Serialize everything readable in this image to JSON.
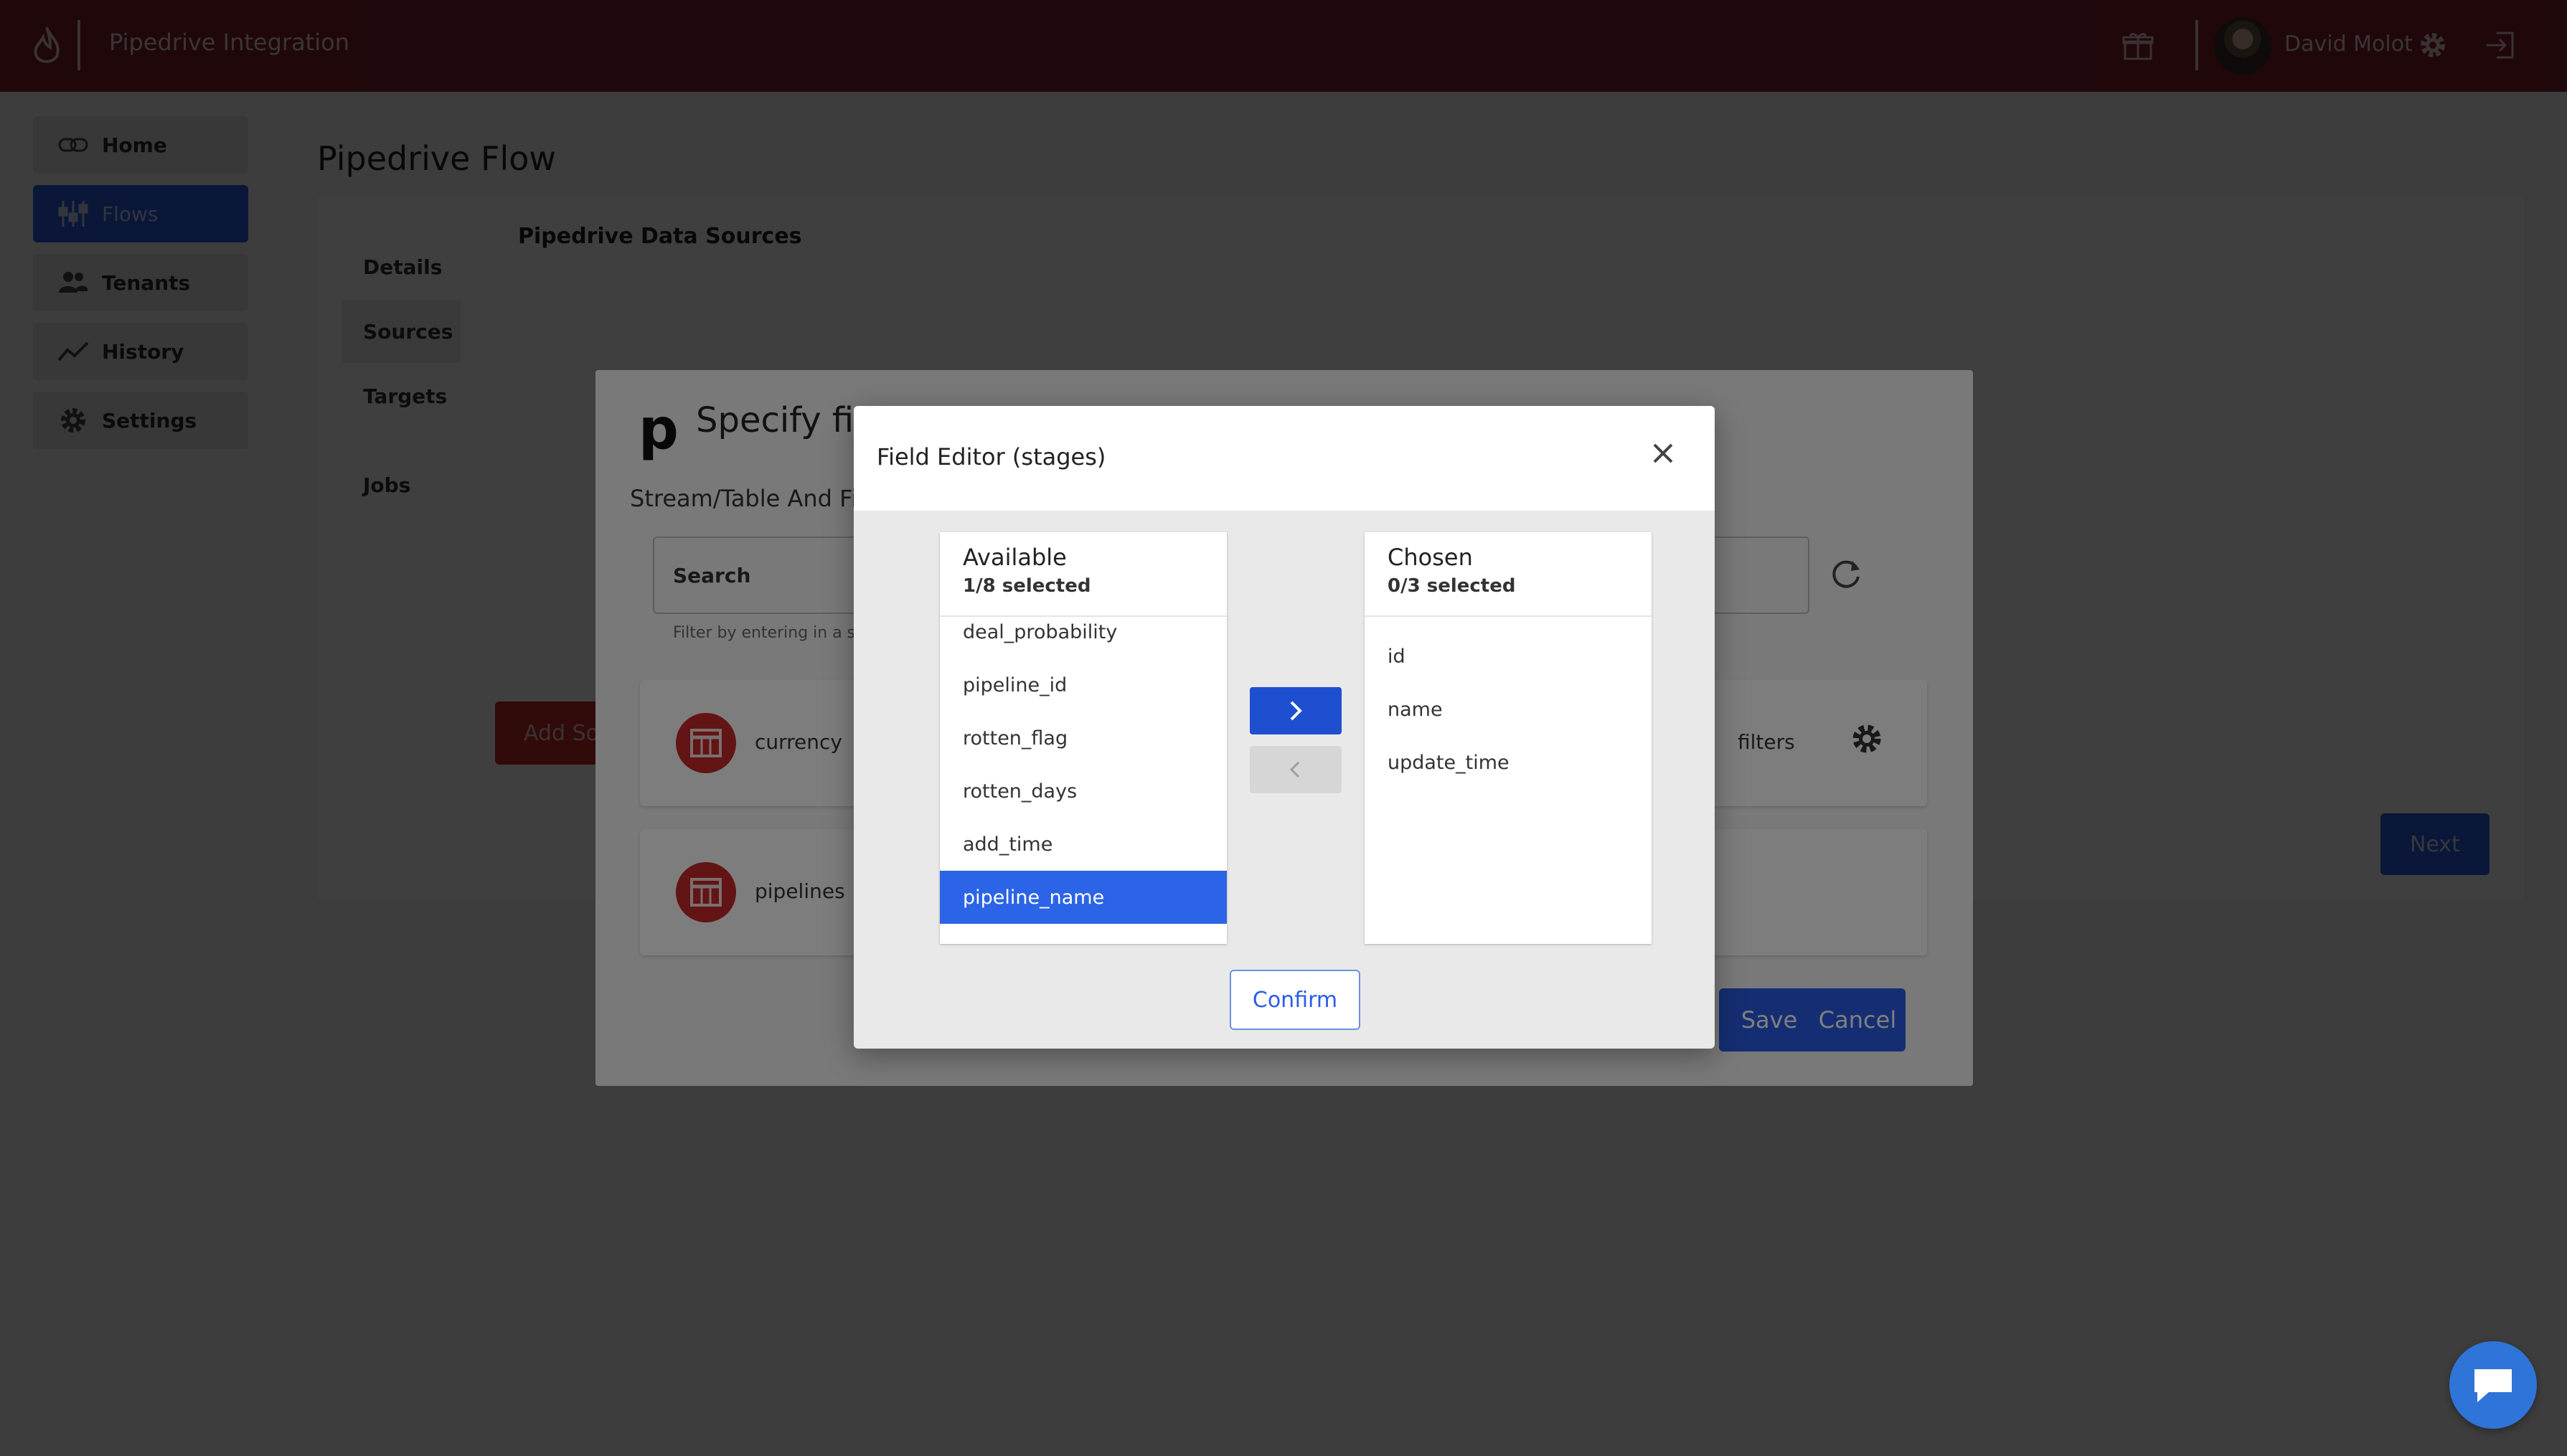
{
  "header": {
    "app_title": "Pipedrive Integration",
    "user_name": "David Molot",
    "brand_color": "#7e1f2b"
  },
  "sidebar": {
    "items": [
      {
        "label": "Home",
        "icon": "link-icon"
      },
      {
        "label": "Flows",
        "icon": "flows-icon",
        "active": true
      },
      {
        "label": "Tenants",
        "icon": "users-icon"
      },
      {
        "label": "History",
        "icon": "chart-line-icon"
      },
      {
        "label": "Settings",
        "icon": "gear-icon"
      }
    ]
  },
  "main": {
    "page_title": "Pipedrive Flow",
    "subnav": [
      "Details",
      "Sources",
      "Targets",
      "Jobs"
    ],
    "section_title": "Pipedrive Data Sources",
    "add_source_label": "Add So",
    "next_label": "Next"
  },
  "specify_dialog": {
    "logo_letter": "p",
    "title_visible": "Specify fie",
    "stream_label_visible": "Stream/Table And Fie",
    "search_label": "Search",
    "search_help_visible": "Filter by entering in a st",
    "streams": [
      {
        "name": "currency",
        "filters_label": "filters"
      },
      {
        "name": "pipelines"
      }
    ],
    "save_label": "Save",
    "cancel_label": "Cancel"
  },
  "field_editor": {
    "title": "Field Editor (stages)",
    "available": {
      "title": "Available",
      "count": "1/8 selected",
      "items": [
        "deal_probability",
        "pipeline_id",
        "rotten_flag",
        "rotten_days",
        "add_time",
        "pipeline_name"
      ],
      "selected_index": 5
    },
    "chosen": {
      "title": "Chosen",
      "count": "0/3 selected",
      "items": [
        "id",
        "name",
        "update_time"
      ]
    },
    "move_right_icon": "chevron-right-icon",
    "move_left_icon": "chevron-left-icon",
    "confirm_label": "Confirm",
    "accent_color": "#2b5ce6"
  }
}
